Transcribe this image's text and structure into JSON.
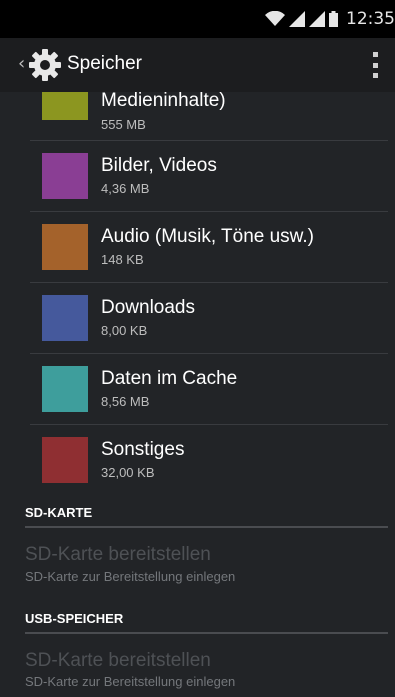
{
  "status_bar": {
    "time": "12:35",
    "icons": [
      "wifi-icon",
      "signal-icon",
      "signal-icon",
      "battery-icon"
    ]
  },
  "action_bar": {
    "title": "Speicher",
    "icons": [
      "back-chevron-icon",
      "settings-gear-icon",
      "overflow-menu-icon"
    ]
  },
  "storage_items": [
    {
      "title": "Medieninhalte)",
      "size": "555 MB",
      "color": "#8c9620"
    },
    {
      "title": "Bilder, Videos",
      "size": "4,36 MB",
      "color": "#8a3e94"
    },
    {
      "title": "Audio (Musik, Töne usw.)",
      "size": "148 KB",
      "color": "#a4622b"
    },
    {
      "title": "Downloads",
      "size": "8,00 KB",
      "color": "#45599c"
    },
    {
      "title": "Daten im Cache",
      "size": "8,56 MB",
      "color": "#3e9e9c"
    },
    {
      "title": "Sonstiges",
      "size": "32,00 KB",
      "color": "#8f2f32"
    }
  ],
  "sections": [
    {
      "header": "SD-KARTE",
      "item_title": "SD-Karte bereitstellen",
      "item_subtitle": "SD-Karte zur Bereitstellung einlegen"
    },
    {
      "header": "USB-SPEICHER",
      "item_title": "SD-Karte bereitstellen",
      "item_subtitle": "SD-Karte zur Bereitstellung einlegen"
    }
  ]
}
